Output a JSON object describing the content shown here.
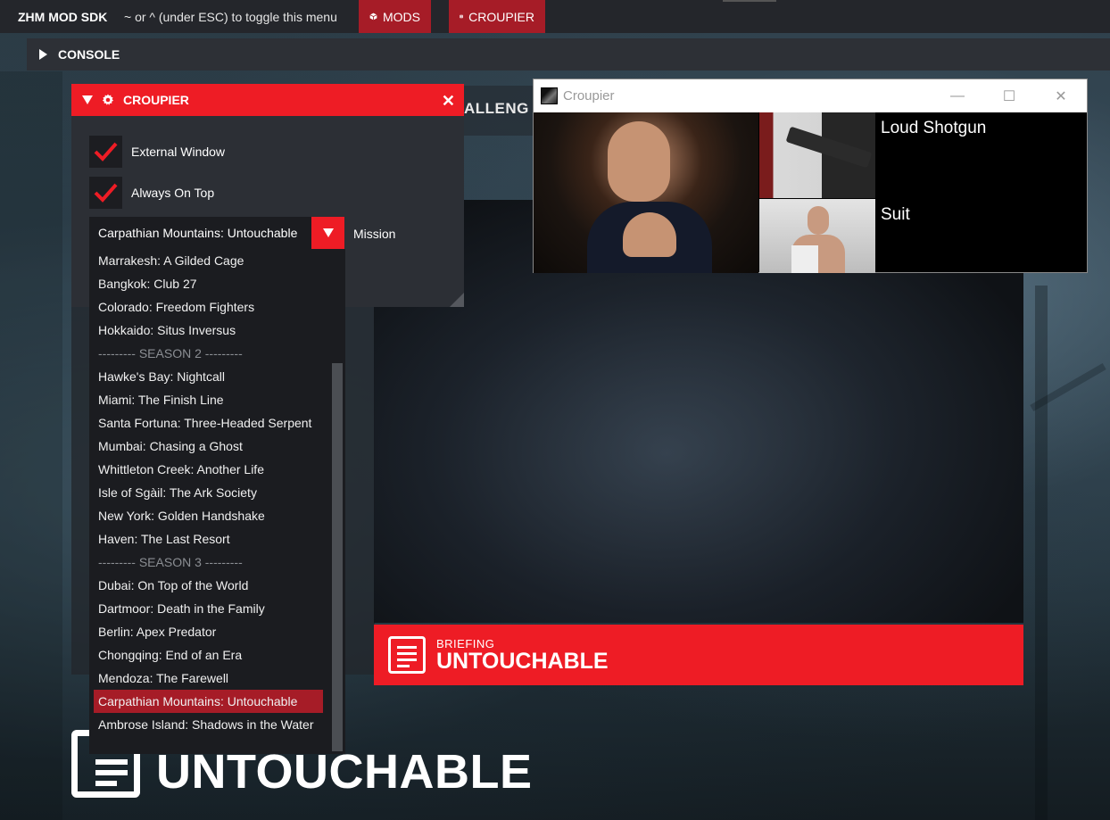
{
  "topbar": {
    "brand": "ZHM MOD SDK",
    "hint": "~ or ^ (under ESC) to toggle this menu",
    "mods_label": "MODS",
    "croupier_label": "CROUPIER"
  },
  "console": {
    "label": "CONSOLE"
  },
  "background": {
    "challenge_text": "ALLENG",
    "briefing_small": "BRIEFING",
    "briefing_big": "UNTOUCHABLE",
    "bottom_title": "UNTOUCHABLE"
  },
  "croupier_panel": {
    "title": "CROUPIER",
    "external_window_label": "External Window",
    "external_window_checked": true,
    "always_on_top_label": "Always On Top",
    "always_on_top_checked": true,
    "mission_label": "Mission",
    "selected_mission": "Carpathian Mountains: Untouchable",
    "dropdown_items": [
      {
        "label": "Marrakesh: A Gilded Cage",
        "kind": "item"
      },
      {
        "label": "Bangkok: Club 27",
        "kind": "item"
      },
      {
        "label": "Colorado: Freedom Fighters",
        "kind": "item"
      },
      {
        "label": "Hokkaido: Situs Inversus",
        "kind": "item"
      },
      {
        "label": "--------- SEASON 2 ---------",
        "kind": "sep"
      },
      {
        "label": "Hawke's Bay: Nightcall",
        "kind": "item"
      },
      {
        "label": "Miami: The Finish Line",
        "kind": "item"
      },
      {
        "label": "Santa Fortuna: Three-Headed Serpent",
        "kind": "item"
      },
      {
        "label": "Mumbai: Chasing a Ghost",
        "kind": "item"
      },
      {
        "label": "Whittleton Creek: Another Life",
        "kind": "item"
      },
      {
        "label": "Isle of Sgàil: The Ark Society",
        "kind": "item"
      },
      {
        "label": "New York: Golden Handshake",
        "kind": "item"
      },
      {
        "label": "Haven: The Last Resort",
        "kind": "item"
      },
      {
        "label": "--------- SEASON 3 ---------",
        "kind": "sep"
      },
      {
        "label": "Dubai: On Top of the World",
        "kind": "item"
      },
      {
        "label": "Dartmoor: Death in the Family",
        "kind": "item"
      },
      {
        "label": "Berlin: Apex Predator",
        "kind": "item"
      },
      {
        "label": "Chongqing: End of an Era",
        "kind": "item"
      },
      {
        "label": "Mendoza: The Farewell",
        "kind": "item"
      },
      {
        "label": "Carpathian Mountains: Untouchable",
        "kind": "sel"
      },
      {
        "label": "Ambrose Island: Shadows in the Water",
        "kind": "item"
      }
    ]
  },
  "external_window": {
    "title": "Croupier",
    "rule_1": "Loud Shotgun",
    "rule_2": "Suit"
  },
  "colors": {
    "accent_red": "#ee1c25",
    "dark_red": "#a61c27",
    "panel_bg": "#2c2f35"
  }
}
